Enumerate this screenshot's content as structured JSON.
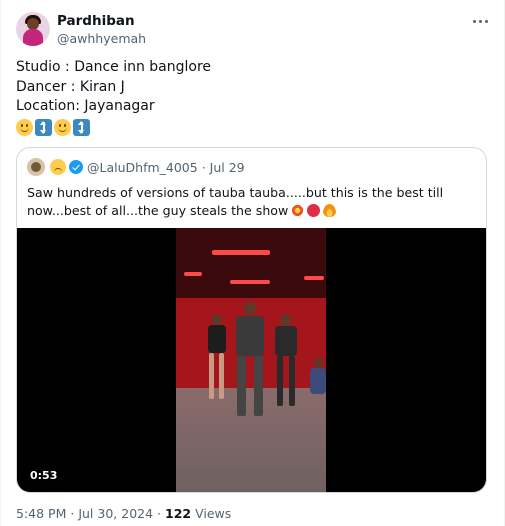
{
  "author": {
    "display_name": "Pardhiban",
    "handle": "@awhhyemah",
    "avatar_icon": "profile-avatar"
  },
  "tweet": {
    "lines": [
      "Studio : Dance inn banglore",
      "Dancer : Kiran J",
      "Location: Jayanagar"
    ],
    "emojis": [
      "slightly-smiling-face",
      "up-down-arrow",
      "slightly-smiling-face",
      "up-down-arrow"
    ]
  },
  "quoted": {
    "handle": "@LaluDhfm_4005",
    "separator": "·",
    "date": "Jul 29",
    "text": "Saw hundreds of versions of tauba tauba.....but this is the best till now...best of all...the guy steals the show",
    "text_emojis": [
      "collision",
      "angry-face",
      "fire"
    ],
    "video": {
      "duration": "0:53"
    }
  },
  "footer": {
    "time": "5:48 PM",
    "separator": "·",
    "date": "Jul 30, 2024",
    "views_count": "122",
    "views_label": "Views"
  },
  "colors": {
    "text": "#0f1419",
    "muted": "#536471",
    "border": "#cfd9de",
    "verified": "#1d9bf0"
  }
}
